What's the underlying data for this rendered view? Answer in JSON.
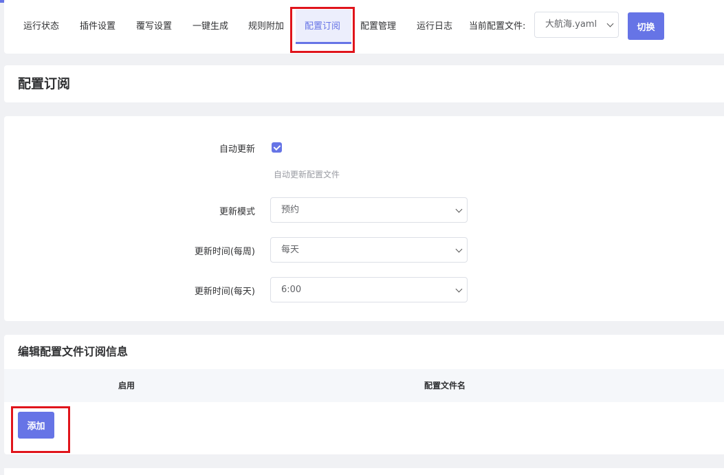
{
  "nav": {
    "tabs": [
      {
        "label": "运行状态",
        "active": false
      },
      {
        "label": "插件设置",
        "active": false
      },
      {
        "label": "覆写设置",
        "active": false
      },
      {
        "label": "一键生成",
        "active": false
      },
      {
        "label": "规则附加",
        "active": false
      },
      {
        "label": "配置订阅",
        "active": true
      },
      {
        "label": "配置管理",
        "active": false
      },
      {
        "label": "运行日志",
        "active": false
      }
    ],
    "profile_label": "当前配置文件:",
    "profile_value": "大航海.yaml",
    "switch_label": "切换"
  },
  "page": {
    "title": "配置订阅"
  },
  "form": {
    "auto_update_label": "自动更新",
    "auto_update_checked": true,
    "auto_update_hint": "自动更新配置文件",
    "mode_label": "更新模式",
    "mode_value": "预约",
    "weekly_label": "更新时间(每周)",
    "weekly_value": "每天",
    "daily_label": "更新时间(每天)",
    "daily_value": "6:00"
  },
  "subscriptions": {
    "title": "编辑配置文件订阅信息",
    "columns": [
      "启用",
      "配置文件名"
    ],
    "add_label": "添加"
  },
  "colors": {
    "accent": "#6674e6",
    "highlight_frame": "#e0141b",
    "page_background": "#f0f1f4"
  }
}
